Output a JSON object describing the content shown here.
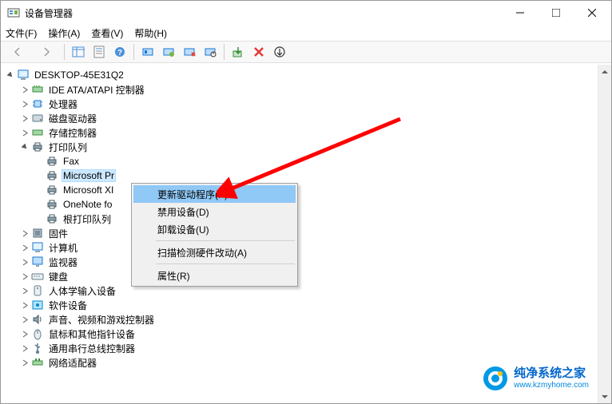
{
  "window": {
    "title": "设备管理器"
  },
  "menubar": {
    "file": "文件(F)",
    "action": "操作(A)",
    "view": "查看(V)",
    "help": "帮助(H)"
  },
  "tree": {
    "root": "DESKTOP-45E31Q2",
    "nodes": {
      "ide": "IDE ATA/ATAPI 控制器",
      "cpu": "处理器",
      "disk": "磁盘驱动器",
      "storage": "存储控制器",
      "printq": "打印队列",
      "fax": "Fax",
      "msprint": "Microsoft Pr",
      "msxl": "Microsoft XI",
      "onenote": "OneNote fo",
      "rootprint": "根打印队列",
      "firmware": "固件",
      "computer": "计算机",
      "monitor": "监视器",
      "keyboard": "键盘",
      "hid": "人体学输入设备",
      "software": "软件设备",
      "sound": "声音、视频和游戏控制器",
      "mouse": "鼠标和其他指针设备",
      "usb": "通用串行总线控制器",
      "network": "网络适配器"
    }
  },
  "context_menu": {
    "update_driver": "更新驱动程序(P)",
    "disable": "禁用设备(D)",
    "uninstall": "卸载设备(U)",
    "scan": "扫描检测硬件改动(A)",
    "properties": "属性(R)"
  },
  "watermark": {
    "title": "纯净系统之家",
    "url": "www.kzmyhome.com"
  }
}
